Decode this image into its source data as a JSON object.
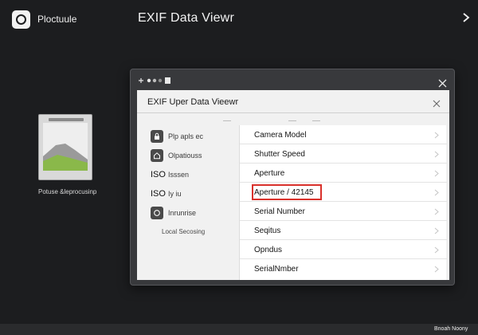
{
  "app": {
    "name": "Ploctuule",
    "title": "EXIF Data Viewr"
  },
  "thumbnail": {
    "caption": "Potuse &leprocusinp"
  },
  "dialog": {
    "title": "EXIF Uper Data Vieewr"
  },
  "sidebar": {
    "items": [
      {
        "icon": "lock-icon",
        "label": "Plp apls ec"
      },
      {
        "icon": "home-icon",
        "label": "Olpatiouss"
      },
      {
        "prefix": "ISO",
        "label": "Isssen"
      },
      {
        "prefix": "ISO",
        "label": "Iy iu"
      },
      {
        "icon": "circle-icon",
        "label": "Inrunrise"
      }
    ],
    "sub_label": "Local Secosing"
  },
  "rows": [
    {
      "label": "Camera Model"
    },
    {
      "label": "Shutter Speed"
    },
    {
      "label": "Aperture"
    },
    {
      "label": "Aperture / 42145",
      "highlighted": true
    },
    {
      "label": "Serial Number"
    },
    {
      "label": "Seqitus"
    },
    {
      "label": "Opndus"
    },
    {
      "label": "SerialNmber"
    }
  ],
  "footer": {
    "text": "Bnoah Noony"
  },
  "colors": {
    "highlight": "#d9312b",
    "background": "#1c1d1f"
  }
}
